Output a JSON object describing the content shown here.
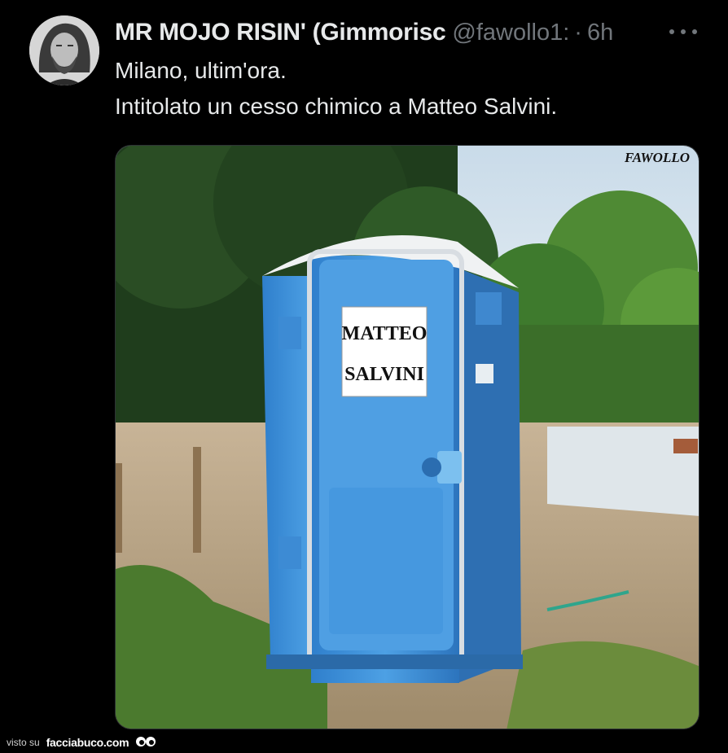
{
  "tweet": {
    "author_name": "MR MOJO RISIN' (Gimmorisc",
    "handle": "@fawollo1:",
    "separator": "·",
    "time": "6h",
    "line1": "Milano, ultim'ora.",
    "line2": "Intitolato un cesso chimico a Matteo Salvini."
  },
  "media": {
    "watermark": "FAWOLLO",
    "sign_line1": "MATTEO",
    "sign_line2": "SALVINI"
  },
  "footer": {
    "visto_label": "visto su",
    "site": "facciabuco.com"
  },
  "colors": {
    "background": "#000000",
    "text": "#e7e9ea",
    "muted": "#71767b",
    "toilet_blue": "#3f8fd6"
  }
}
